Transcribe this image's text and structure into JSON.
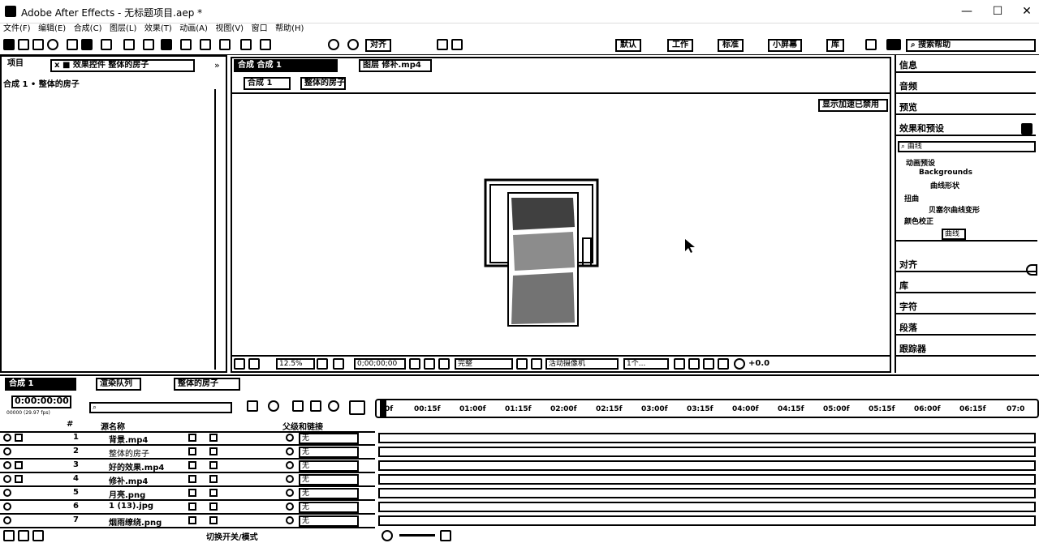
{
  "window": {
    "title": "Adobe After Effects - 无标题项目.aep *",
    "minimize": "—",
    "maximize": "☐",
    "close": "✕"
  },
  "menu": [
    "文件(F)",
    "编辑(E)",
    "合成(C)",
    "图层(L)",
    "效果(T)",
    "动画(A)",
    "视图(V)",
    "窗口",
    "帮助(H)"
  ],
  "toolbar": {
    "snap_label": "对齐",
    "workspaces": [
      "默认",
      "工作",
      "标准",
      "小屏幕",
      "库"
    ],
    "search_help": "搜索帮助"
  },
  "left_panel": {
    "tab_project": "项目",
    "tab_effects": "效果控件 整体的房子",
    "breadcrumb": "合成 1 • 整体的房子"
  },
  "comp_panel": {
    "tab_comp": "合成 合成 1",
    "tab_layer": "图层 修补.mp4",
    "flow_comp": "合成 1",
    "flow_layer": "整体的房子",
    "accel_notice": "显示加速已禁用",
    "zoom": "12.5%",
    "timecode": "0;00;00;00",
    "resolution": "完整",
    "camera": "活动摄像机",
    "views": "1个...",
    "exposure": "+0.0"
  },
  "right_panel": {
    "items_top": [
      "信息",
      "音频",
      "预览",
      "效果和预设"
    ],
    "search_value": "曲线",
    "tree": [
      "动画预设",
      "Backgrounds",
      "曲线形状",
      "扭曲",
      "贝塞尔曲线变形",
      "颜色校正",
      "曲线"
    ],
    "items_bottom": [
      "对齐",
      "库",
      "字符",
      "段落",
      "跟踪器"
    ]
  },
  "timeline": {
    "tab_comp": "合成 1",
    "tab_render": "渲染队列",
    "tab_layer": "整体的房子",
    "timecode": "0:00:00:00",
    "timecode_sub": "00000 (29.97 fps)",
    "search_placeholder": "",
    "col_num": "#",
    "col_source": "源名称",
    "col_parent": "父级和链接",
    "ruler": [
      "0f",
      "00:15f",
      "01:00f",
      "01:15f",
      "02:00f",
      "02:15f",
      "03:00f",
      "03:15f",
      "04:00f",
      "04:15f",
      "05:00f",
      "05:15f",
      "06:00f",
      "06:15f",
      "07:0"
    ],
    "layers": [
      {
        "num": "1",
        "name": "背景.mp4",
        "parent": "无"
      },
      {
        "num": "2",
        "name": "整体的房子",
        "parent": "无"
      },
      {
        "num": "3",
        "name": "好的效果.mp4",
        "parent": "无"
      },
      {
        "num": "4",
        "name": "修补.mp4",
        "parent": "无"
      },
      {
        "num": "5",
        "name": "月亮.png",
        "parent": "无"
      },
      {
        "num": "6",
        "name": "1 (13).jpg",
        "parent": "无"
      },
      {
        "num": "7",
        "name": "烟雨缭绕.png",
        "parent": "无"
      }
    ],
    "toggle_modes": "切换开关/模式"
  }
}
